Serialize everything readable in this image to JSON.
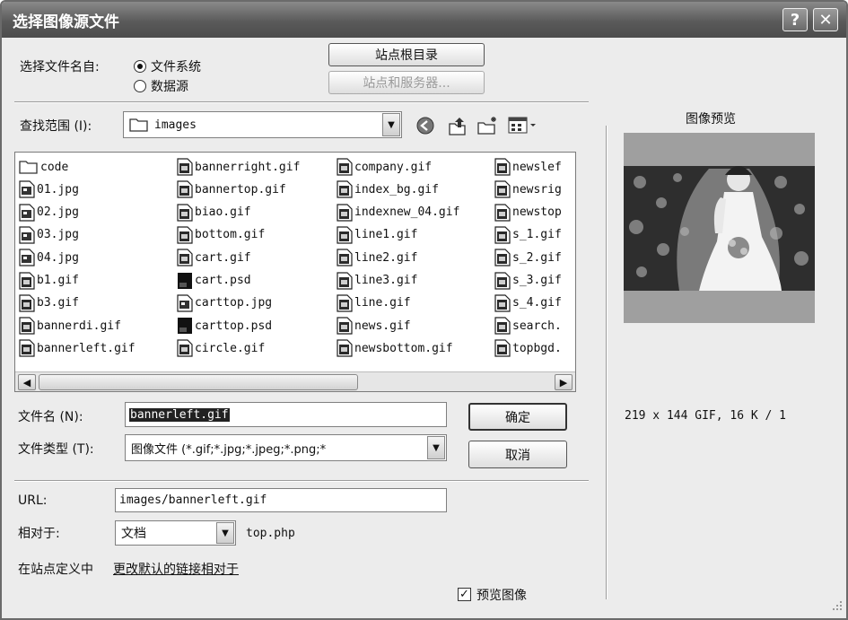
{
  "window": {
    "title": "选择图像源文件",
    "help_label": "?",
    "close_label": "✕"
  },
  "select_from": {
    "label": "选择文件名自:",
    "options": [
      "文件系统",
      "数据源"
    ],
    "selected": "文件系统"
  },
  "buttons": {
    "site_root": "站点根目录",
    "site_server": "站点和服务器...",
    "ok": "确定",
    "cancel": "取消"
  },
  "look_in": {
    "label": "查找范围 (I):",
    "value": "images"
  },
  "toolbar_icons": [
    "back-icon",
    "up-folder-icon",
    "new-folder-icon",
    "view-menu-icon"
  ],
  "files": {
    "columns": [
      [
        "code",
        "01.jpg",
        "02.jpg",
        "03.jpg",
        "04.jpg",
        "b1.gif",
        "b3.gif",
        "bannerdi.gif",
        "bannerleft.gif"
      ],
      [
        "bannerright.gif",
        "bannertop.gif",
        "biao.gif",
        "bottom.gif",
        "cart.gif",
        "cart.psd",
        "carttop.jpg",
        "carttop.psd",
        "circle.gif"
      ],
      [
        "company.gif",
        "index_bg.gif",
        "indexnew_04.gif",
        "line1.gif",
        "line2.gif",
        "line3.gif",
        "line.gif",
        "news.gif",
        "newsbottom.gif"
      ],
      [
        "newslef",
        "newsrig",
        "newstop",
        "s_1.gif",
        "s_2.gif",
        "s_3.gif",
        "s_4.gif",
        "search.",
        "topbgd."
      ]
    ]
  },
  "filename": {
    "label": "文件名 (N):",
    "value": "bannerleft.gif"
  },
  "filetype": {
    "label": "文件类型 (T):",
    "value": "图像文件 (*.gif;*.jpg;*.jpeg;*.png;*"
  },
  "url": {
    "label": "URL:",
    "value": "images/bannerleft.gif"
  },
  "relative": {
    "label": "相对于:",
    "value": "文档",
    "page": "top.php"
  },
  "change_default": {
    "prefix": "在站点定义中",
    "link": "更改默认的链接相对于"
  },
  "preview": {
    "title": "图像预览",
    "info": "219 x 144 GIF, 16 K / 1",
    "checkbox_label": "预览图像",
    "checked": true
  }
}
